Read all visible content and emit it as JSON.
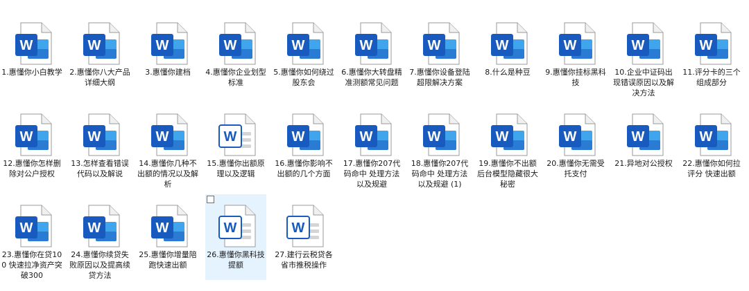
{
  "files": [
    {
      "name": "1.惠懂你小白教学"
    },
    {
      "name": "2.惠懂你八大产品详细大纲"
    },
    {
      "name": "3.惠懂你建档"
    },
    {
      "name": "4.惠懂你企业划型标准"
    },
    {
      "name": "5.惠懂你如何绕过股东会"
    },
    {
      "name": "6.惠懂你大转盘精准测额常见问题"
    },
    {
      "name": "7.惠懂你设备登陆超限解决方案"
    },
    {
      "name": "8.什么是种豆"
    },
    {
      "name": "9.惠懂你挂标黑科技"
    },
    {
      "name": "10.企业中证码出现错误原因以及解决方法"
    },
    {
      "name": "11.评分卡的三个组成部分"
    },
    {
      "name": "12.惠懂你怎样删除对公户授权"
    },
    {
      "name": "13.怎样查看错误代码以及解说"
    },
    {
      "name": "14.惠懂你几种不出额的情况以及解析"
    },
    {
      "name": "15.惠懂你出额原理以及逻辑",
      "icon_style": "outline"
    },
    {
      "name": "16.惠懂你影响不出额的几个方面"
    },
    {
      "name": "17.惠懂你207代码命中 处理方法以及规避"
    },
    {
      "name": "18.惠懂你207代码命中 处理方法以及规避 (1)"
    },
    {
      "name": "19.惠懂你不出额后台模型隐藏很大秘密"
    },
    {
      "name": "20.惠懂你无需受托支付"
    },
    {
      "name": "21.异地对公授权"
    },
    {
      "name": "22.惠懂你如何拉评分 快速出额"
    },
    {
      "name": "23.惠懂你在贷100 快速拉净资产突破300"
    },
    {
      "name": "24.惠懂你续贷失败原因以及提高续贷方法"
    },
    {
      "name": "25.惠懂你增量陪跑快速出额"
    },
    {
      "name": "26.惠懂你黑科技提额",
      "icon_style": "outline",
      "selected": true
    },
    {
      "name": "27.建行云税贷各省市推税操作",
      "icon_style": "outline"
    }
  ],
  "icon_letter": "W",
  "colors": {
    "word_blue": "#185abd",
    "word_blue_light": "#41a5ee",
    "selection_bg": "#e5f3ff"
  }
}
